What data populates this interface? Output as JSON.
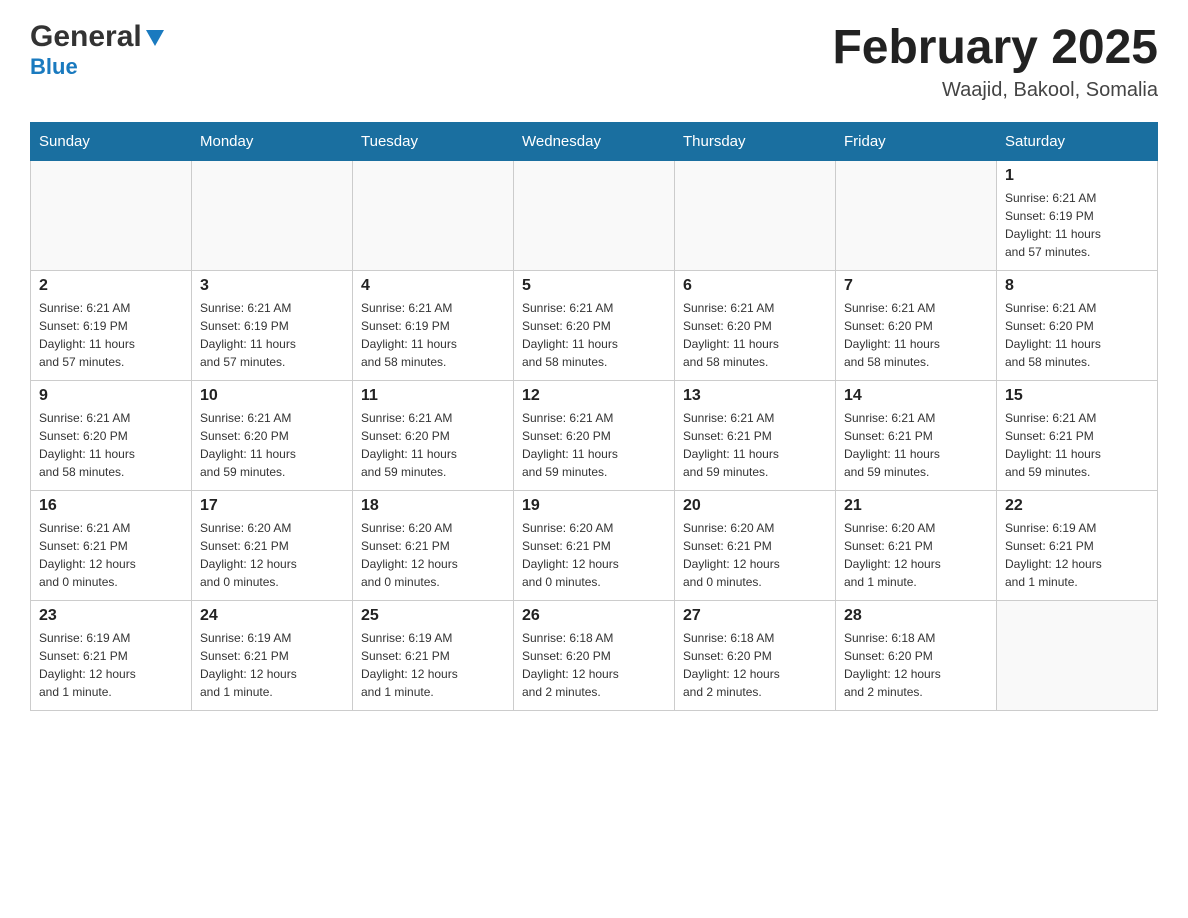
{
  "header": {
    "logo_general": "General",
    "logo_blue": "Blue",
    "month_title": "February 2025",
    "location": "Waajid, Bakool, Somalia"
  },
  "days_of_week": [
    "Sunday",
    "Monday",
    "Tuesday",
    "Wednesday",
    "Thursday",
    "Friday",
    "Saturday"
  ],
  "weeks": [
    {
      "days": [
        {
          "num": "",
          "info": ""
        },
        {
          "num": "",
          "info": ""
        },
        {
          "num": "",
          "info": ""
        },
        {
          "num": "",
          "info": ""
        },
        {
          "num": "",
          "info": ""
        },
        {
          "num": "",
          "info": ""
        },
        {
          "num": "1",
          "info": "Sunrise: 6:21 AM\nSunset: 6:19 PM\nDaylight: 11 hours\nand 57 minutes."
        }
      ]
    },
    {
      "days": [
        {
          "num": "2",
          "info": "Sunrise: 6:21 AM\nSunset: 6:19 PM\nDaylight: 11 hours\nand 57 minutes."
        },
        {
          "num": "3",
          "info": "Sunrise: 6:21 AM\nSunset: 6:19 PM\nDaylight: 11 hours\nand 57 minutes."
        },
        {
          "num": "4",
          "info": "Sunrise: 6:21 AM\nSunset: 6:19 PM\nDaylight: 11 hours\nand 58 minutes."
        },
        {
          "num": "5",
          "info": "Sunrise: 6:21 AM\nSunset: 6:20 PM\nDaylight: 11 hours\nand 58 minutes."
        },
        {
          "num": "6",
          "info": "Sunrise: 6:21 AM\nSunset: 6:20 PM\nDaylight: 11 hours\nand 58 minutes."
        },
        {
          "num": "7",
          "info": "Sunrise: 6:21 AM\nSunset: 6:20 PM\nDaylight: 11 hours\nand 58 minutes."
        },
        {
          "num": "8",
          "info": "Sunrise: 6:21 AM\nSunset: 6:20 PM\nDaylight: 11 hours\nand 58 minutes."
        }
      ]
    },
    {
      "days": [
        {
          "num": "9",
          "info": "Sunrise: 6:21 AM\nSunset: 6:20 PM\nDaylight: 11 hours\nand 58 minutes."
        },
        {
          "num": "10",
          "info": "Sunrise: 6:21 AM\nSunset: 6:20 PM\nDaylight: 11 hours\nand 59 minutes."
        },
        {
          "num": "11",
          "info": "Sunrise: 6:21 AM\nSunset: 6:20 PM\nDaylight: 11 hours\nand 59 minutes."
        },
        {
          "num": "12",
          "info": "Sunrise: 6:21 AM\nSunset: 6:20 PM\nDaylight: 11 hours\nand 59 minutes."
        },
        {
          "num": "13",
          "info": "Sunrise: 6:21 AM\nSunset: 6:21 PM\nDaylight: 11 hours\nand 59 minutes."
        },
        {
          "num": "14",
          "info": "Sunrise: 6:21 AM\nSunset: 6:21 PM\nDaylight: 11 hours\nand 59 minutes."
        },
        {
          "num": "15",
          "info": "Sunrise: 6:21 AM\nSunset: 6:21 PM\nDaylight: 11 hours\nand 59 minutes."
        }
      ]
    },
    {
      "days": [
        {
          "num": "16",
          "info": "Sunrise: 6:21 AM\nSunset: 6:21 PM\nDaylight: 12 hours\nand 0 minutes."
        },
        {
          "num": "17",
          "info": "Sunrise: 6:20 AM\nSunset: 6:21 PM\nDaylight: 12 hours\nand 0 minutes."
        },
        {
          "num": "18",
          "info": "Sunrise: 6:20 AM\nSunset: 6:21 PM\nDaylight: 12 hours\nand 0 minutes."
        },
        {
          "num": "19",
          "info": "Sunrise: 6:20 AM\nSunset: 6:21 PM\nDaylight: 12 hours\nand 0 minutes."
        },
        {
          "num": "20",
          "info": "Sunrise: 6:20 AM\nSunset: 6:21 PM\nDaylight: 12 hours\nand 0 minutes."
        },
        {
          "num": "21",
          "info": "Sunrise: 6:20 AM\nSunset: 6:21 PM\nDaylight: 12 hours\nand 1 minute."
        },
        {
          "num": "22",
          "info": "Sunrise: 6:19 AM\nSunset: 6:21 PM\nDaylight: 12 hours\nand 1 minute."
        }
      ]
    },
    {
      "days": [
        {
          "num": "23",
          "info": "Sunrise: 6:19 AM\nSunset: 6:21 PM\nDaylight: 12 hours\nand 1 minute."
        },
        {
          "num": "24",
          "info": "Sunrise: 6:19 AM\nSunset: 6:21 PM\nDaylight: 12 hours\nand 1 minute."
        },
        {
          "num": "25",
          "info": "Sunrise: 6:19 AM\nSunset: 6:21 PM\nDaylight: 12 hours\nand 1 minute."
        },
        {
          "num": "26",
          "info": "Sunrise: 6:18 AM\nSunset: 6:20 PM\nDaylight: 12 hours\nand 2 minutes."
        },
        {
          "num": "27",
          "info": "Sunrise: 6:18 AM\nSunset: 6:20 PM\nDaylight: 12 hours\nand 2 minutes."
        },
        {
          "num": "28",
          "info": "Sunrise: 6:18 AM\nSunset: 6:20 PM\nDaylight: 12 hours\nand 2 minutes."
        },
        {
          "num": "",
          "info": ""
        }
      ]
    }
  ]
}
